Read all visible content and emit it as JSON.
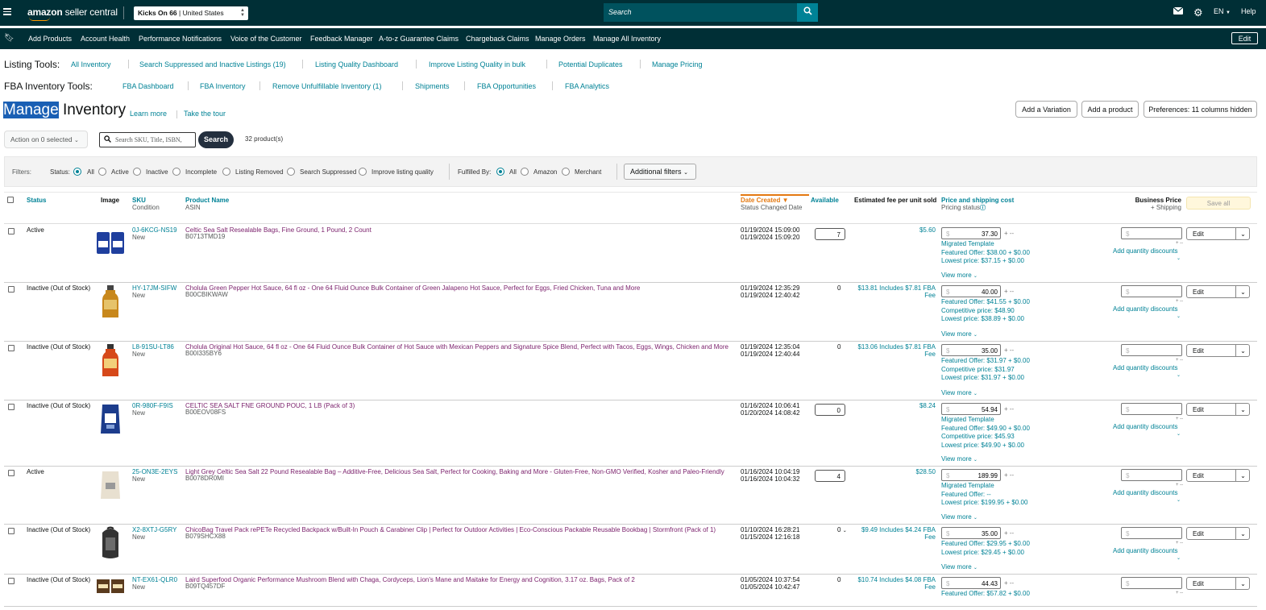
{
  "topbar": {
    "logo_main": "amazon",
    "logo_sub": "seller central",
    "store_name": "Kicks On 66",
    "store_region": "| United States",
    "search_placeholder": "Search",
    "lang": "EN",
    "help": "Help"
  },
  "nav": [
    "Add Products",
    "Account Health",
    "Performance Notifications",
    "Voice of the Customer",
    "Feedback Manager",
    "A-to-z Guarantee Claims",
    "Chargeback Claims",
    "Manage Orders",
    "Manage All Inventory"
  ],
  "nav_edit": "Edit",
  "listing_tools": {
    "label": "Listing Tools:",
    "links": [
      "All Inventory",
      "Search Suppressed and Inactive Listings (19)",
      "Listing Quality Dashboard",
      "Improve Listing Quality in bulk",
      "Potential Duplicates",
      "Manage Pricing"
    ]
  },
  "fba_tools": {
    "label": "FBA Inventory Tools:",
    "links": [
      "FBA Dashboard",
      "FBA Inventory",
      "Remove Unfulfillable Inventory (1)",
      "Shipments",
      "FBA Opportunities",
      "FBA Analytics"
    ]
  },
  "page": {
    "title_highlight": "Manage",
    "title_rest": " Inventory",
    "learn_more": "Learn more",
    "take_tour": "Take the tour",
    "add_variation": "Add a Variation",
    "add_product": "Add a product",
    "preferences": "Preferences: 11 columns hidden"
  },
  "toolbar": {
    "action": "Action on 0 selected",
    "search_placeholder": "Search SKU, Title, ISBN,",
    "search_button": "Search",
    "count": "32 product(s)"
  },
  "filters": {
    "label": "Filters:",
    "status_label": "Status:",
    "status_options": [
      "All",
      "Active",
      "Inactive",
      "Incomplete",
      "Listing Removed",
      "Search Suppressed",
      "Improve listing quality"
    ],
    "fulfilled_label": "Fulfilled By:",
    "fulfilled_options": [
      "All",
      "Amazon",
      "Merchant"
    ],
    "additional": "Additional filters"
  },
  "columns": {
    "status": "Status",
    "image": "Image",
    "sku": "SKU",
    "sku_sub": "Condition",
    "product": "Product Name",
    "product_sub": "ASIN",
    "date": "Date Created",
    "date_sub": "Status Changed Date",
    "available": "Available",
    "fee": "Estimated fee per unit sold",
    "price": "Price and shipping cost",
    "price_sub": "Pricing status",
    "business": "Business Price",
    "business_sub": "+ Shipping",
    "save_all": "Save all"
  },
  "rows": [
    {
      "status": "Active",
      "sku": "0J-6KCG-NS19",
      "cond": "New",
      "title": "Celtic Sea Salt Resealable Bags, Fine Ground, 1 Pound, 2 Count",
      "asin": "B0713TMD19",
      "d1": "01/19/2024 15:09:00",
      "d2": "01/19/2024 15:09:20",
      "avail": "7",
      "fee": "$5.60",
      "price": "37.30",
      "lines": [
        "Migrated Template",
        "Featured Offer: $38.00 + $0.00",
        "Lowest price: $37.15 + $0.00"
      ],
      "view": "View more"
    },
    {
      "status": "Inactive (Out of Stock)",
      "sku": "HY-17JM-SIFW",
      "cond": "New",
      "title": "Cholula Green Pepper Hot Sauce, 64 fl oz - One 64 Fluid Ounce Bulk Container of Green Jalapeno Hot Sauce, Perfect for Eggs, Fried Chicken, Tuna and More",
      "asin": "B00CBIKWAW",
      "d1": "01/19/2024 12:35:29",
      "d2": "01/19/2024 12:40:42",
      "avail": "0",
      "fee": "$13.81 Includes $7.81 FBA Fee",
      "price": "40.00",
      "lines": [
        "Featured Offer: $41.55 + $0.00",
        "Competitive price: $48.90",
        "Lowest price: $38.89 + $0.00"
      ],
      "view": "View more"
    },
    {
      "status": "Inactive (Out of Stock)",
      "sku": "L8-91SU-LT86",
      "cond": "New",
      "title": "Cholula Original Hot Sauce, 64 fl oz - One 64 Fluid Ounce Bulk Container of Hot Sauce with Mexican Peppers and Signature Spice Blend, Perfect with Tacos, Eggs, Wings, Chicken and More",
      "asin": "B00I335BY6",
      "d1": "01/19/2024 12:35:04",
      "d2": "01/19/2024 12:40:44",
      "avail": "0",
      "fee": "$13.06 Includes $7.81 FBA Fee",
      "price": "35.00",
      "lines": [
        "Featured Offer: $31.97 + $0.00",
        "Competitive price: $31.97",
        "Lowest price: $31.97 + $0.00"
      ],
      "view": "View more"
    },
    {
      "status": "Inactive (Out of Stock)",
      "sku": "0R-980F-F9IS",
      "cond": "New",
      "title": "CELTIC SEA SALT FNE GROUND POUC, 1 LB (Pack of 3)",
      "asin": "B00EOV08FS",
      "d1": "01/16/2024 10:06:41",
      "d2": "01/20/2024 14:08:42",
      "avail": "0",
      "fee": "$8.24",
      "price": "54.94",
      "lines": [
        "Migrated Template",
        "Featured Offer: $49.90 + $0.00",
        "Competitive price: $45.93",
        "Lowest price: $49.90 + $0.00"
      ],
      "view": "View more"
    },
    {
      "status": "Active",
      "sku": "25-ON3E-2EYS",
      "cond": "New",
      "title": "Light Grey Celtic Sea Salt 22 Pound Resealable Bag – Additive-Free, Delicious Sea Salt, Perfect for Cooking, Baking and More - Gluten-Free, Non-GMO Verified, Kosher and Paleo-Friendly",
      "asin": "B0078DR0MI",
      "d1": "01/16/2024 10:04:19",
      "d2": "01/16/2024 10:04:32",
      "avail": "4",
      "fee": "$28.50",
      "price": "189.99",
      "lines": [
        "Migrated Template",
        "Featured Offer: --",
        "Lowest price: $199.95 + $0.00"
      ],
      "view": "View more"
    },
    {
      "status": "Inactive (Out of Stock)",
      "sku": "X2-8XTJ-G5RY",
      "cond": "New",
      "title": "ChicoBag Travel Pack rePETe Recycled Backpack w/Built-In Pouch & Carabiner Clip | Perfect for Outdoor Activities | Eco-Conscious Packable Reusable Bookbag | Stormfront (Pack of 1)",
      "asin": "B079SHCX88",
      "d1": "01/10/2024 16:28:21",
      "d2": "01/15/2024 12:16:18",
      "avail": "0",
      "fee": "$9.49 Includes $4.24 FBA Fee",
      "price": "35.00",
      "lines": [
        "Featured Offer: $29.95 + $0.00",
        "Lowest price: $29.45 + $0.00"
      ],
      "view": "View more"
    },
    {
      "status": "Inactive (Out of Stock)",
      "sku": "NT-EX61-QLR0",
      "cond": "New",
      "title": "Laird Superfood Organic Performance Mushroom Blend with Chaga, Cordyceps, Lion's Mane and Maitake for Energy and Cognition, 3.17 oz. Bags, Pack of 2",
      "asin": "B09TQ457DF",
      "d1": "01/05/2024 10:37:54",
      "d2": "01/05/2024 10:42:47",
      "avail": "0",
      "fee": "$10.74 Includes $4.08 FBA Fee",
      "price": "44.43",
      "lines": [
        "Featured Offer: $57.82 + $0.00"
      ],
      "view": ""
    }
  ],
  "add_qty": "Add quantity discounts",
  "edit": "Edit"
}
